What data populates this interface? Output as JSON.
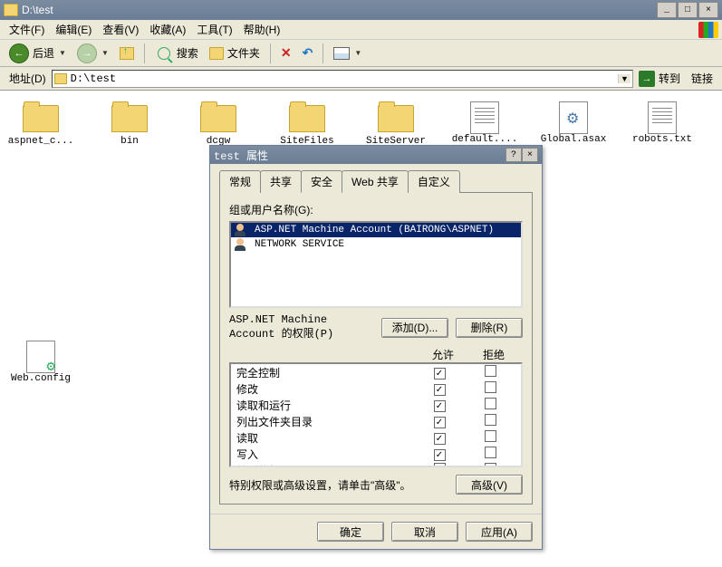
{
  "window": {
    "title": "D:\\test",
    "minimize": "_",
    "maximize": "□",
    "close": "×"
  },
  "menu": {
    "file": "文件(F)",
    "edit": "编辑(E)",
    "view": "查看(V)",
    "favorites": "收藏(A)",
    "tools": "工具(T)",
    "help": "帮助(H)"
  },
  "toolbar": {
    "back": "后退",
    "search": "搜索",
    "folders": "文件夹"
  },
  "address": {
    "label": "地址(D)",
    "path": "D:\\test",
    "go": "转到",
    "links": "链接"
  },
  "files": [
    {
      "name": "aspnet_c...",
      "type": "folder"
    },
    {
      "name": "bin",
      "type": "folder"
    },
    {
      "name": "dcgw",
      "type": "folder"
    },
    {
      "name": "SiteFiles",
      "type": "folder"
    },
    {
      "name": "SiteServer",
      "type": "folder"
    },
    {
      "name": "default....",
      "type": "txt"
    },
    {
      "name": "Global.asax",
      "type": "asax"
    },
    {
      "name": "robots.txt",
      "type": "txt"
    },
    {
      "name": "Web.config",
      "type": "cfg"
    }
  ],
  "dialog": {
    "title": "test 属性",
    "help": "?",
    "close": "×",
    "tabs": {
      "general": "常规",
      "sharing": "共享",
      "security": "安全",
      "websharing": "Web 共享",
      "customize": "自定义"
    },
    "groups_label": "组或用户名称(G):",
    "users": [
      {
        "name": "ASP.NET Machine Account (BAIRONG\\ASPNET)",
        "selected": true
      },
      {
        "name": "NETWORK SERVICE",
        "selected": false
      }
    ],
    "perm_for_label": "ASP.NET Machine Account 的权限(P)",
    "add_btn": "添加(D)...",
    "remove_btn": "删除(R)",
    "allow_col": "允许",
    "deny_col": "拒绝",
    "permissions": [
      {
        "name": "完全控制",
        "allow": true,
        "deny": false
      },
      {
        "name": "修改",
        "allow": true,
        "deny": false
      },
      {
        "name": "读取和运行",
        "allow": true,
        "deny": false
      },
      {
        "name": "列出文件夹目录",
        "allow": true,
        "deny": false
      },
      {
        "name": "读取",
        "allow": true,
        "deny": false
      },
      {
        "name": "写入",
        "allow": true,
        "deny": false
      },
      {
        "name": "特别的权限",
        "allow": false,
        "deny": false
      }
    ],
    "special_label": "特别权限或高级设置，请单击\"高级\"。",
    "advanced_btn": "高级(V)",
    "ok": "确定",
    "cancel": "取消",
    "apply": "应用(A)"
  }
}
